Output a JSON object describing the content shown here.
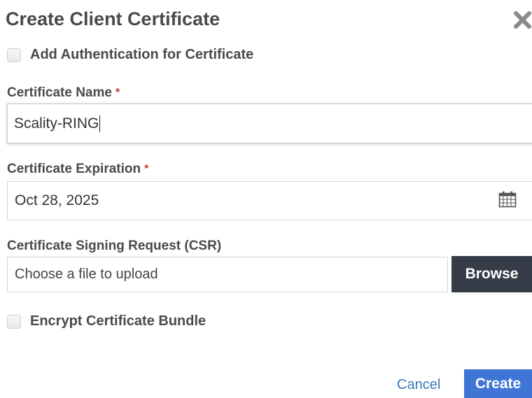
{
  "dialog": {
    "title": "Create Client Certificate",
    "close_icon": "close-icon"
  },
  "auth_checkbox": {
    "label": "Add Authentication for Certificate",
    "checked": false
  },
  "certificate_name": {
    "label": "Certificate Name",
    "required_mark": "*",
    "value": "Scality-RING"
  },
  "certificate_expiration": {
    "label": "Certificate Expiration",
    "required_mark": "*",
    "value": "Oct 28, 2025",
    "icon": "calendar-icon"
  },
  "csr": {
    "label": "Certificate Signing Request (CSR)",
    "placeholder": "Choose a file to upload",
    "browse_label": "Browse"
  },
  "encrypt_checkbox": {
    "label": "Encrypt Certificate Bundle",
    "checked": false
  },
  "actions": {
    "cancel_label": "Cancel",
    "create_label": "Create"
  },
  "colors": {
    "primary": "#3f76d6",
    "dark_button": "#363d48",
    "link": "#3e78b8",
    "required": "#c0392b"
  }
}
